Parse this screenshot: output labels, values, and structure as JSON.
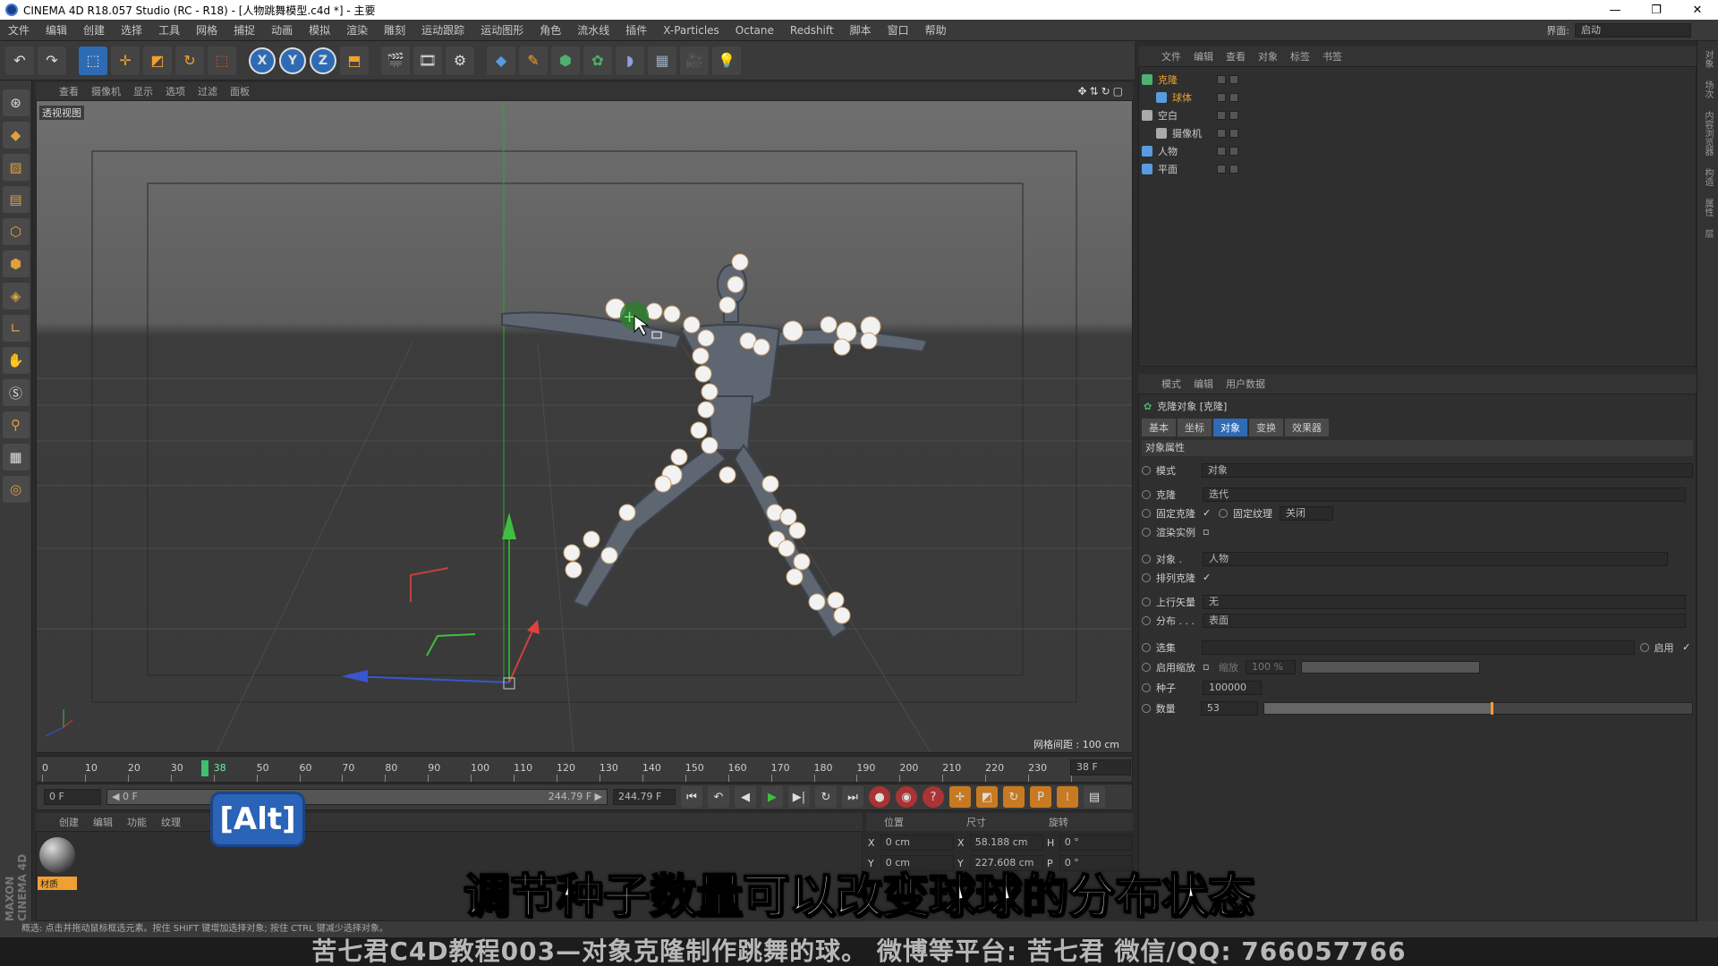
{
  "window": {
    "title": "CINEMA 4D R18.057 Studio (RC - R18) - [人物跳舞模型.c4d *] - 主要",
    "controls": [
      "—",
      "❐",
      "✕"
    ]
  },
  "menu": {
    "items": [
      "文件",
      "编辑",
      "创建",
      "选择",
      "工具",
      "网格",
      "捕捉",
      "动画",
      "模拟",
      "渲染",
      "雕刻",
      "运动跟踪",
      "运动图形",
      "角色",
      "流水线",
      "插件",
      "X-Particles",
      "Octane",
      "Redshift",
      "脚本",
      "窗口",
      "帮助"
    ],
    "layout_label": "界面:",
    "layout_value": "启动"
  },
  "toolbar": {
    "undo": "↶",
    "axis_x": "X",
    "axis_y": "Y",
    "axis_z": "Z"
  },
  "viewport": {
    "menu": [
      "查看",
      "摄像机",
      "显示",
      "选项",
      "过滤",
      "面板"
    ],
    "label": "透视视图",
    "grid_spacing": "网格间距 : 100 cm",
    "nav_icons": "✥⇅↻▢"
  },
  "timeline": {
    "ticks": [
      "0",
      "10",
      "20",
      "30",
      "38",
      "50",
      "60",
      "70",
      "80",
      "90",
      "100",
      "110",
      "120",
      "130",
      "140",
      "150",
      "160",
      "170",
      "180",
      "190",
      "200",
      "210",
      "220",
      "230",
      "240"
    ],
    "current_frame_ratio": 0.155,
    "current_frame": "38 F"
  },
  "playback": {
    "start": "0 F",
    "range_start": "◀ 0 F",
    "range_end": "244.79 F ▶",
    "end": "244.79 F",
    "buttons": [
      "⏮",
      "↶",
      "◀",
      "▶",
      "▶|",
      "↻",
      "⏭"
    ]
  },
  "materials": {
    "menu": [
      "创建",
      "编辑",
      "功能",
      "纹理"
    ],
    "item_label": "材质"
  },
  "coords": {
    "headers": [
      "位置",
      "尺寸",
      "旋转"
    ],
    "rows": [
      {
        "a_label": "X",
        "a": "0 cm",
        "b_label": "X",
        "b": "58.188 cm",
        "c_label": "H",
        "c": "0 °"
      },
      {
        "a_label": "Y",
        "a": "0 cm",
        "b_label": "Y",
        "b": "227.608 cm",
        "c_label": "P",
        "c": "0 °"
      }
    ]
  },
  "alt_key": "[Alt]",
  "subtitle": "调节种子数量可以改变球球的分布状态",
  "status": "概选: 点击并拖动鼠标框选元素。按住 SHIFT 键增加选择对象; 按住 CTRL 键减少选择对象。",
  "footer": "苦七君C4D教程003—对象克隆制作跳舞的球。   微博等平台: 苦七君   微信/QQ: 766057766",
  "maxon": "MAXON CINEMA 4D",
  "object_manager": {
    "menu": [
      "文件",
      "编辑",
      "查看",
      "对象",
      "标签",
      "书签"
    ],
    "objects": [
      {
        "name": "克隆",
        "selected": true,
        "icon_color": "#4fb06f",
        "indent": 0
      },
      {
        "name": "球体",
        "selected": true,
        "icon_color": "#5a9be0",
        "indent": 1
      },
      {
        "name": "空白",
        "selected": false,
        "icon_color": "#aaaaaa",
        "indent": 0
      },
      {
        "name": "摄像机",
        "selected": false,
        "icon_color": "#aaaaaa",
        "indent": 1
      },
      {
        "name": "人物",
        "selected": false,
        "icon_color": "#5a9be0",
        "indent": 0
      },
      {
        "name": "平面",
        "selected": false,
        "icon_color": "#5a9be0",
        "indent": 0
      }
    ]
  },
  "attributes": {
    "menu": [
      "模式",
      "编辑",
      "用户数据"
    ],
    "title": "克隆对象 [克隆]",
    "tabs": [
      "基本",
      "坐标",
      "对象",
      "变换",
      "效果器"
    ],
    "active_tab": "对象",
    "section": "对象属性",
    "mode_label": "模式",
    "mode_value": "对象",
    "clone_label": "克隆",
    "clone_value": "迭代",
    "fixed_clone_label": "固定克隆",
    "fixed_texture_label": "固定纹理",
    "fixed_texture_value": "关闭",
    "render_instances_label": "渲染实例",
    "object_label": "对象 .",
    "object_value": "人物",
    "arrange_label": "排列克隆",
    "up_vector_label": "上行矢量",
    "up_vector_value": "无",
    "distribution_label": "分布 . . .",
    "distribution_value": "表面",
    "selection_label": "选集",
    "enable_label": "启用",
    "enable_scale_label": "启用缩放",
    "scale_label": "缩放",
    "scale_value": "100 %",
    "seed_label": "种子",
    "seed_value": "100000",
    "count_label": "数量",
    "count_value": "53",
    "count_ratio": 0.53
  },
  "right_tabs": [
    "对象",
    "场次",
    "内容浏览器",
    "构造",
    "属性",
    "层"
  ]
}
